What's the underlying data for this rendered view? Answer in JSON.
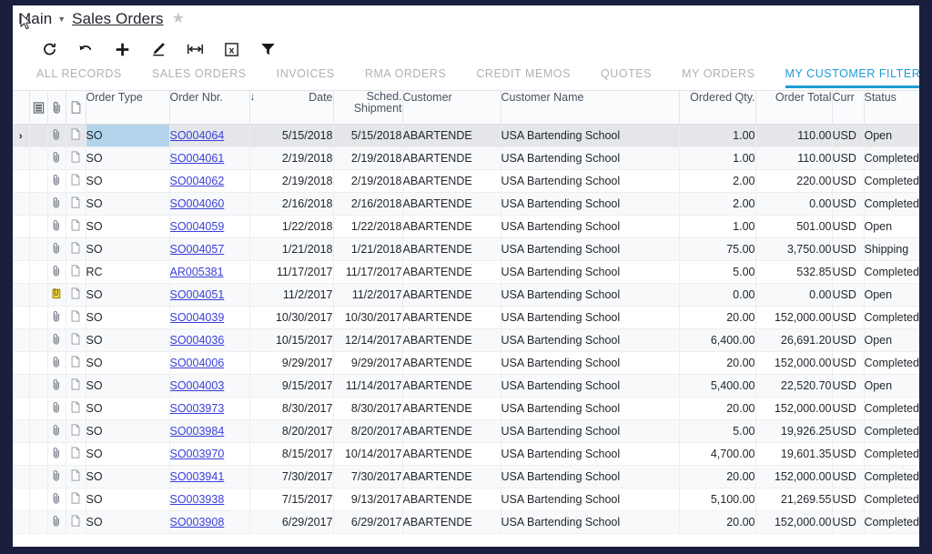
{
  "window": {
    "frame_color": "#1a1f3d"
  },
  "titlebar": {
    "module": "Main",
    "caret_icon": "chevron-down-icon",
    "page_title": "Sales Orders",
    "favorite_icon": "star-icon"
  },
  "toolbar": {
    "buttons": [
      {
        "name": "refresh-button",
        "icon": "refresh-icon",
        "label": "Refresh"
      },
      {
        "name": "undo-button",
        "icon": "undo-arrow-icon",
        "label": "Cancel"
      },
      {
        "name": "add-button",
        "icon": "plus-icon",
        "label": "Add New Record"
      },
      {
        "name": "edit-button",
        "icon": "pencil-icon",
        "label": "Edit"
      },
      {
        "name": "fit-columns-button",
        "icon": "fit-width-icon",
        "label": "Adjust Column Widths"
      },
      {
        "name": "export-excel-button",
        "icon": "excel-x-icon",
        "label": "Export to Excel"
      },
      {
        "name": "filter-button",
        "icon": "funnel-icon",
        "label": "Filter Settings"
      }
    ]
  },
  "tabs": {
    "active_color": "#1e9ad6",
    "items": [
      {
        "label": "ALL RECORDS",
        "active": false
      },
      {
        "label": "SALES ORDERS",
        "active": false
      },
      {
        "label": "INVOICES",
        "active": false
      },
      {
        "label": "RMA ORDERS",
        "active": false
      },
      {
        "label": "CREDIT MEMOS",
        "active": false
      },
      {
        "label": "QUOTES",
        "active": false
      },
      {
        "label": "MY ORDERS",
        "active": false
      },
      {
        "label": "MY CUSTOMER FILTER",
        "active": true
      }
    ]
  },
  "grid": {
    "selected_row_index": 0,
    "selected_cell_column": "order_type",
    "sort_column": "Date",
    "sort_direction": "descending",
    "columns": [
      {
        "key": "marker",
        "label": "",
        "icon": "",
        "align": "center",
        "width": 18
      },
      {
        "key": "settings",
        "label": "",
        "icon": "grid-settings-icon",
        "align": "center",
        "width": 20
      },
      {
        "key": "files",
        "label": "",
        "icon": "paperclip-icon",
        "align": "center",
        "width": 20
      },
      {
        "key": "notes",
        "label": "",
        "icon": "note-page-icon",
        "align": "center",
        "width": 22
      },
      {
        "key": "order_type",
        "label": "Order Type",
        "align": "left",
        "width": 92
      },
      {
        "key": "order_nbr",
        "label": "Order Nbr.",
        "align": "left",
        "width": 88
      },
      {
        "key": "date",
        "label": "Date",
        "align": "right",
        "width": 92
      },
      {
        "key": "sched_shipment",
        "label": "Sched. Shipment",
        "align": "right",
        "width": 76
      },
      {
        "key": "customer",
        "label": "Customer",
        "align": "left",
        "width": 108
      },
      {
        "key": "customer_name",
        "label": "Customer Name",
        "align": "left",
        "width": 196
      },
      {
        "key": "ordered_qty",
        "label": "Ordered Qty.",
        "align": "right",
        "width": 84
      },
      {
        "key": "order_total",
        "label": "Order Total",
        "align": "right",
        "width": 84
      },
      {
        "key": "curr",
        "label": "Curr",
        "align": "left",
        "width": 35
      },
      {
        "key": "status",
        "label": "Status",
        "align": "left",
        "width": 80
      }
    ],
    "rows": [
      {
        "marker": "›",
        "note_flag": false,
        "order_type": "SO",
        "order_nbr": "SO004064",
        "date": "5/15/2018",
        "sched_shipment": "5/15/2018",
        "customer": "ABARTENDE",
        "customer_name": "USA Bartending School",
        "ordered_qty": "1.00",
        "order_total": "110.00",
        "curr": "USD",
        "status": "Open"
      },
      {
        "marker": "",
        "note_flag": false,
        "order_type": "SO",
        "order_nbr": "SO004061",
        "date": "2/19/2018",
        "sched_shipment": "2/19/2018",
        "customer": "ABARTENDE",
        "customer_name": "USA Bartending School",
        "ordered_qty": "1.00",
        "order_total": "110.00",
        "curr": "USD",
        "status": "Completed"
      },
      {
        "marker": "",
        "note_flag": false,
        "order_type": "SO",
        "order_nbr": "SO004062",
        "date": "2/19/2018",
        "sched_shipment": "2/19/2018",
        "customer": "ABARTENDE",
        "customer_name": "USA Bartending School",
        "ordered_qty": "2.00",
        "order_total": "220.00",
        "curr": "USD",
        "status": "Completed"
      },
      {
        "marker": "",
        "note_flag": false,
        "order_type": "SO",
        "order_nbr": "SO004060",
        "date": "2/16/2018",
        "sched_shipment": "2/16/2018",
        "customer": "ABARTENDE",
        "customer_name": "USA Bartending School",
        "ordered_qty": "2.00",
        "order_total": "0.00",
        "curr": "USD",
        "status": "Completed"
      },
      {
        "marker": "",
        "note_flag": false,
        "order_type": "SO",
        "order_nbr": "SO004059",
        "date": "1/22/2018",
        "sched_shipment": "1/22/2018",
        "customer": "ABARTENDE",
        "customer_name": "USA Bartending School",
        "ordered_qty": "1.00",
        "order_total": "501.00",
        "curr": "USD",
        "status": "Open"
      },
      {
        "marker": "",
        "note_flag": false,
        "order_type": "SO",
        "order_nbr": "SO004057",
        "date": "1/21/2018",
        "sched_shipment": "1/21/2018",
        "customer": "ABARTENDE",
        "customer_name": "USA Bartending School",
        "ordered_qty": "75.00",
        "order_total": "3,750.00",
        "curr": "USD",
        "status": "Shipping"
      },
      {
        "marker": "",
        "note_flag": false,
        "order_type": "RC",
        "order_nbr": "AR005381",
        "date": "11/17/2017",
        "sched_shipment": "11/17/2017",
        "customer": "ABARTENDE",
        "customer_name": "USA Bartending School",
        "ordered_qty": "5.00",
        "order_total": "532.85",
        "curr": "USD",
        "status": "Completed"
      },
      {
        "marker": "",
        "note_flag": true,
        "order_type": "SO",
        "order_nbr": "SO004051",
        "date": "11/2/2017",
        "sched_shipment": "11/2/2017",
        "customer": "ABARTENDE",
        "customer_name": "USA Bartending School",
        "ordered_qty": "0.00",
        "order_total": "0.00",
        "curr": "USD",
        "status": "Open"
      },
      {
        "marker": "",
        "note_flag": false,
        "order_type": "SO",
        "order_nbr": "SO004039",
        "date": "10/30/2017",
        "sched_shipment": "10/30/2017",
        "customer": "ABARTENDE",
        "customer_name": "USA Bartending School",
        "ordered_qty": "20.00",
        "order_total": "152,000.00",
        "curr": "USD",
        "status": "Completed"
      },
      {
        "marker": "",
        "note_flag": false,
        "order_type": "SO",
        "order_nbr": "SO004036",
        "date": "10/15/2017",
        "sched_shipment": "12/14/2017",
        "customer": "ABARTENDE",
        "customer_name": "USA Bartending School",
        "ordered_qty": "6,400.00",
        "order_total": "26,691.20",
        "curr": "USD",
        "status": "Open"
      },
      {
        "marker": "",
        "note_flag": false,
        "order_type": "SO",
        "order_nbr": "SO004006",
        "date": "9/29/2017",
        "sched_shipment": "9/29/2017",
        "customer": "ABARTENDE",
        "customer_name": "USA Bartending School",
        "ordered_qty": "20.00",
        "order_total": "152,000.00",
        "curr": "USD",
        "status": "Completed"
      },
      {
        "marker": "",
        "note_flag": false,
        "order_type": "SO",
        "order_nbr": "SO004003",
        "date": "9/15/2017",
        "sched_shipment": "11/14/2017",
        "customer": "ABARTENDE",
        "customer_name": "USA Bartending School",
        "ordered_qty": "5,400.00",
        "order_total": "22,520.70",
        "curr": "USD",
        "status": "Open"
      },
      {
        "marker": "",
        "note_flag": false,
        "order_type": "SO",
        "order_nbr": "SO003973",
        "date": "8/30/2017",
        "sched_shipment": "8/30/2017",
        "customer": "ABARTENDE",
        "customer_name": "USA Bartending School",
        "ordered_qty": "20.00",
        "order_total": "152,000.00",
        "curr": "USD",
        "status": "Completed"
      },
      {
        "marker": "",
        "note_flag": false,
        "order_type": "SO",
        "order_nbr": "SO003984",
        "date": "8/20/2017",
        "sched_shipment": "8/20/2017",
        "customer": "ABARTENDE",
        "customer_name": "USA Bartending School",
        "ordered_qty": "5.00",
        "order_total": "19,926.25",
        "curr": "USD",
        "status": "Completed"
      },
      {
        "marker": "",
        "note_flag": false,
        "order_type": "SO",
        "order_nbr": "SO003970",
        "date": "8/15/2017",
        "sched_shipment": "10/14/2017",
        "customer": "ABARTENDE",
        "customer_name": "USA Bartending School",
        "ordered_qty": "4,700.00",
        "order_total": "19,601.35",
        "curr": "USD",
        "status": "Completed"
      },
      {
        "marker": "",
        "note_flag": false,
        "order_type": "SO",
        "order_nbr": "SO003941",
        "date": "7/30/2017",
        "sched_shipment": "7/30/2017",
        "customer": "ABARTENDE",
        "customer_name": "USA Bartending School",
        "ordered_qty": "20.00",
        "order_total": "152,000.00",
        "curr": "USD",
        "status": "Completed"
      },
      {
        "marker": "",
        "note_flag": false,
        "order_type": "SO",
        "order_nbr": "SO003938",
        "date": "7/15/2017",
        "sched_shipment": "9/13/2017",
        "customer": "ABARTENDE",
        "customer_name": "USA Bartending School",
        "ordered_qty": "5,100.00",
        "order_total": "21,269.55",
        "curr": "USD",
        "status": "Completed"
      },
      {
        "marker": "",
        "note_flag": false,
        "order_type": "SO",
        "order_nbr": "SO003908",
        "date": "6/29/2017",
        "sched_shipment": "6/29/2017",
        "customer": "ABARTENDE",
        "customer_name": "USA Bartending School",
        "ordered_qty": "20.00",
        "order_total": "152,000.00",
        "curr": "USD",
        "status": "Completed"
      }
    ]
  },
  "cursor": {
    "icon": "mouse-pointer-icon"
  }
}
